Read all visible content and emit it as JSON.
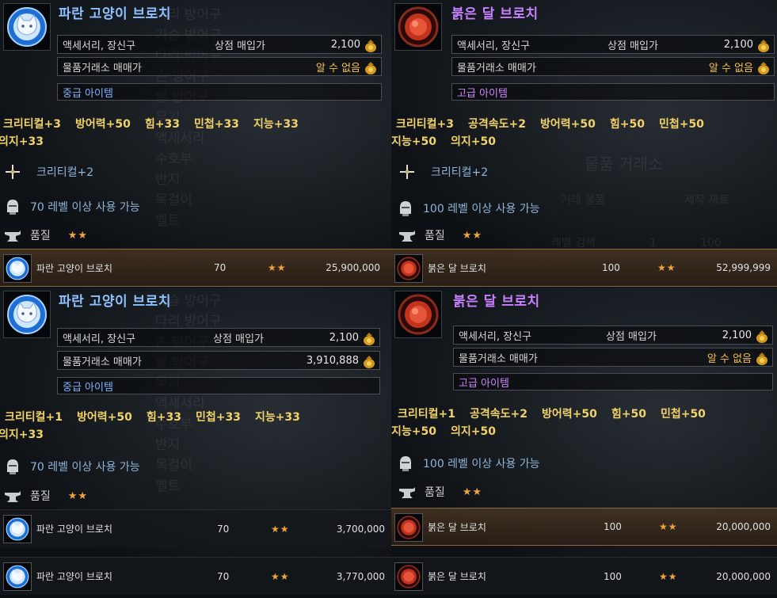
{
  "common": {
    "category": "액세서리, 장신구",
    "shop_buy_label": "상점 매입가",
    "shop_buy_value": "2,100",
    "market_label": "물품거래소 매매가",
    "unknown_price": "알 수 없음",
    "quality_label": "품질",
    "stars": "★★"
  },
  "background_ghost": {
    "left_top": "다리 방어구\n가슴 방어구\n다리 방어구\n손 방어구\n발 방어구\n무기\n액세서리\n수호부\n반지\n목걸이\n벨트",
    "right_market_title": "물품 거래소",
    "right_tab_trade": "거래 물품",
    "right_tab_craft": "제작 재료",
    "right_level_search": "레벨 검색",
    "right_level_from": "1",
    "right_level_to": "100",
    "left_bottom": "가슴 방어구\n다리 방어구\n손 방어구\n발 방어구\n무기\n액세서리\n수호부\n반지\n목걸이\n벨트"
  },
  "panels": [
    {
      "item_name": "파란 고양이 브로치",
      "market_price": "알 수 없음",
      "grade": "중급 아이템",
      "stats": [
        "크리티컬+3",
        "방어력+50",
        "힘+33",
        "민첩+33",
        "지능+33"
      ],
      "stats_line2": [
        "의지+33"
      ],
      "bonus": "크리티컬+2",
      "level_req": "70 레벨 이상 사용 가능",
      "listings": [
        {
          "name": "파란 고양이 브로치",
          "level": "70",
          "stars": "★★",
          "price": "25,900,000"
        }
      ]
    },
    {
      "item_name": "붉은 달 브로치",
      "market_price": "알 수 없음",
      "grade": "고급 아이템",
      "stats": [
        "크리티컬+3",
        "공격속도+2",
        "방어력+50",
        "힘+50",
        "민첩+50"
      ],
      "stats_line2": [
        "지능+50",
        "의지+50"
      ],
      "bonus": "크리티컬+2",
      "level_req": "100 레벨 이상 사용 가능",
      "listings": [
        {
          "name": "붉은 달 브로치",
          "level": "100",
          "stars": "★★",
          "price": "52,999,999"
        }
      ]
    },
    {
      "item_name": "파란 고양이 브로치",
      "market_price": "3,910,888",
      "grade": "중급 아이템",
      "stats": [
        "크리티컬+1",
        "방어력+50",
        "힘+33",
        "민첩+33",
        "지능+33"
      ],
      "stats_line2": [
        "의지+33"
      ],
      "level_req": "70 레벨 이상 사용 가능",
      "listings": [
        {
          "name": "파란 고양이 브로치",
          "level": "70",
          "stars": "★★",
          "price": "3,700,000"
        },
        {
          "name": "파란 고양이 브로치",
          "level": "70",
          "stars": "★★",
          "price": "3,770,000"
        }
      ]
    },
    {
      "item_name": "붉은 달 브로치",
      "market_price": "알 수 없음",
      "grade": "고급 아이템",
      "stats": [
        "크리티컬+1",
        "공격속도+2",
        "방어력+50",
        "힘+50",
        "민첩+50"
      ],
      "stats_line2": [
        "지능+50",
        "의지+50"
      ],
      "level_req": "100 레벨 이상 사용 가능",
      "listings": [
        {
          "name": "붉은 달 브로치",
          "level": "100",
          "stars": "★★",
          "price": "20,000,000"
        },
        {
          "name": "붉은 달 브로치",
          "level": "100",
          "stars": "★★",
          "price": "20,000,000"
        }
      ]
    }
  ],
  "colors": {
    "title_blue": "#8ec0ff",
    "title_purple": "#c980ff",
    "stat_gold": "#f2d36a",
    "star_orange": "#f2a33a",
    "highlight_border": "#8a6a3e"
  }
}
